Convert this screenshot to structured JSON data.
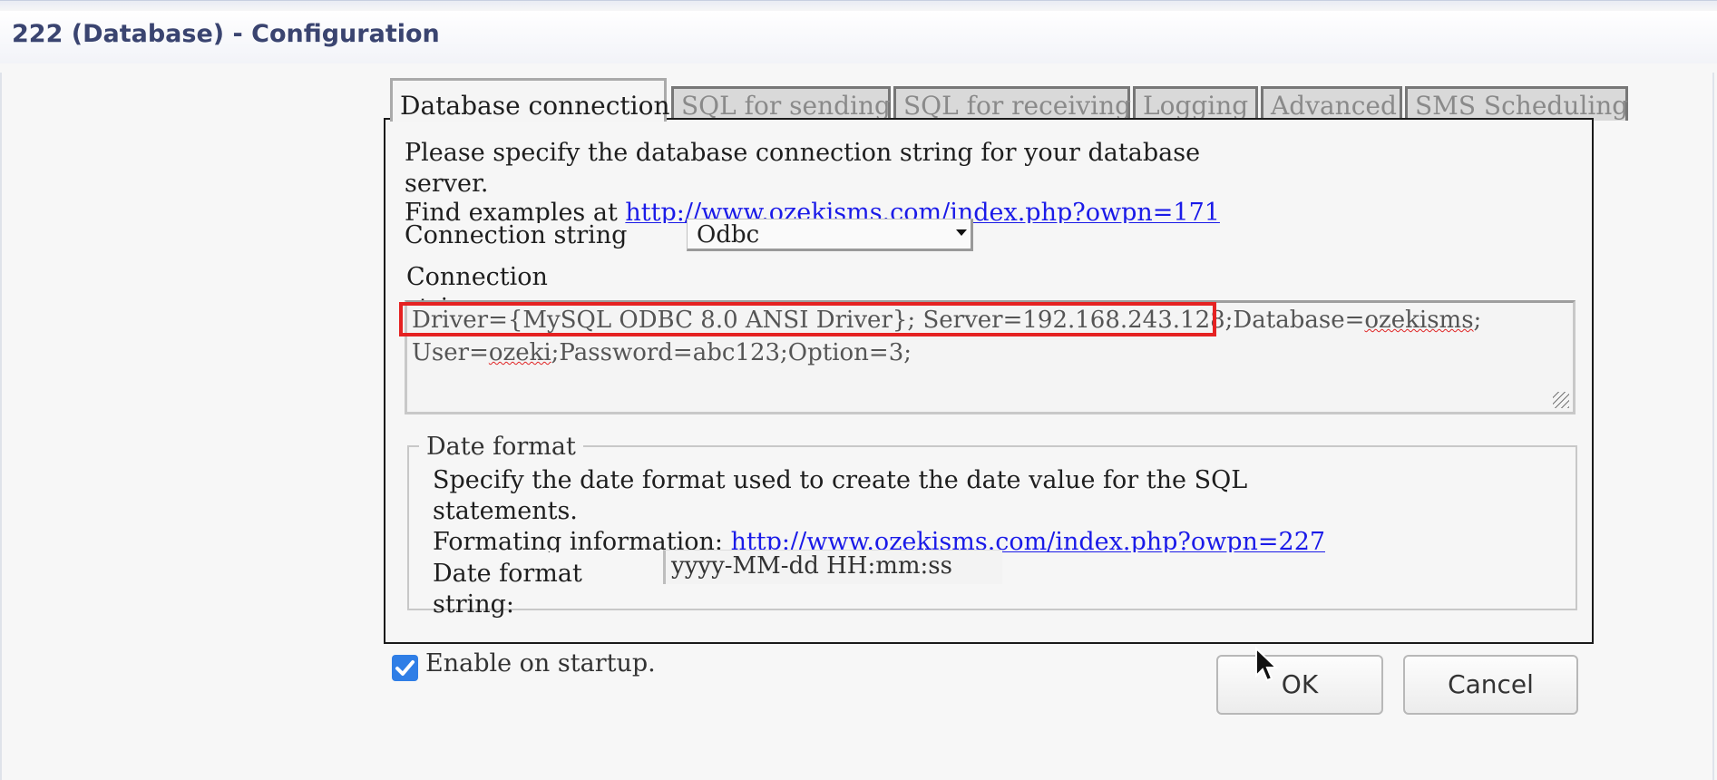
{
  "window": {
    "title": "222 (Database) - Configuration"
  },
  "tabs": [
    {
      "label": "Database connection",
      "active": true
    },
    {
      "label": "SQL for sending",
      "active": false
    },
    {
      "label": "SQL for receiving",
      "active": false
    },
    {
      "label": "Logging",
      "active": false
    },
    {
      "label": "Advanced",
      "active": false
    },
    {
      "label": "SMS Scheduling",
      "active": false
    }
  ],
  "connection": {
    "intro_line1": "Please specify the database connection string for your database",
    "intro_line2": "server.",
    "examples_prefix": "Find examples at ",
    "examples_link": "http://www.ozekisms.com/index.php?owpn=171",
    "type_label": "Connection string",
    "type_value": "Odbc",
    "string_label_1": "Connection",
    "string_label_2": "string:",
    "string_line1_a": "Driver={MySQL ODBC 8.0 ANSI Driver}; Server=192.168.243.128;",
    "string_line1_b": "Database=",
    "string_line1_c": "ozekisms",
    "string_line1_d": ";",
    "string_line2_a": "User=",
    "string_line2_b": "ozeki",
    "string_line2_c": ";Password=abc123;Option=3;"
  },
  "date_format": {
    "legend": "Date format",
    "desc_line1": "Specify the date format used to create the date value for the SQL",
    "desc_line2": "statements.",
    "info_prefix": "Formating information: ",
    "info_link": "http://www.ozekisms.com/index.php?owpn=227",
    "label_1": "Date format",
    "label_2": "string:",
    "value": "yyyy-MM-dd HH:mm:ss"
  },
  "footer": {
    "enable_label": "Enable on startup.",
    "enable_checked": true,
    "ok_label": "OK",
    "cancel_label": "Cancel"
  },
  "colors": {
    "title": "#3a4470",
    "link": "#1a1ae8",
    "highlight": "#e52222",
    "checkbox": "#2f7ee6"
  }
}
